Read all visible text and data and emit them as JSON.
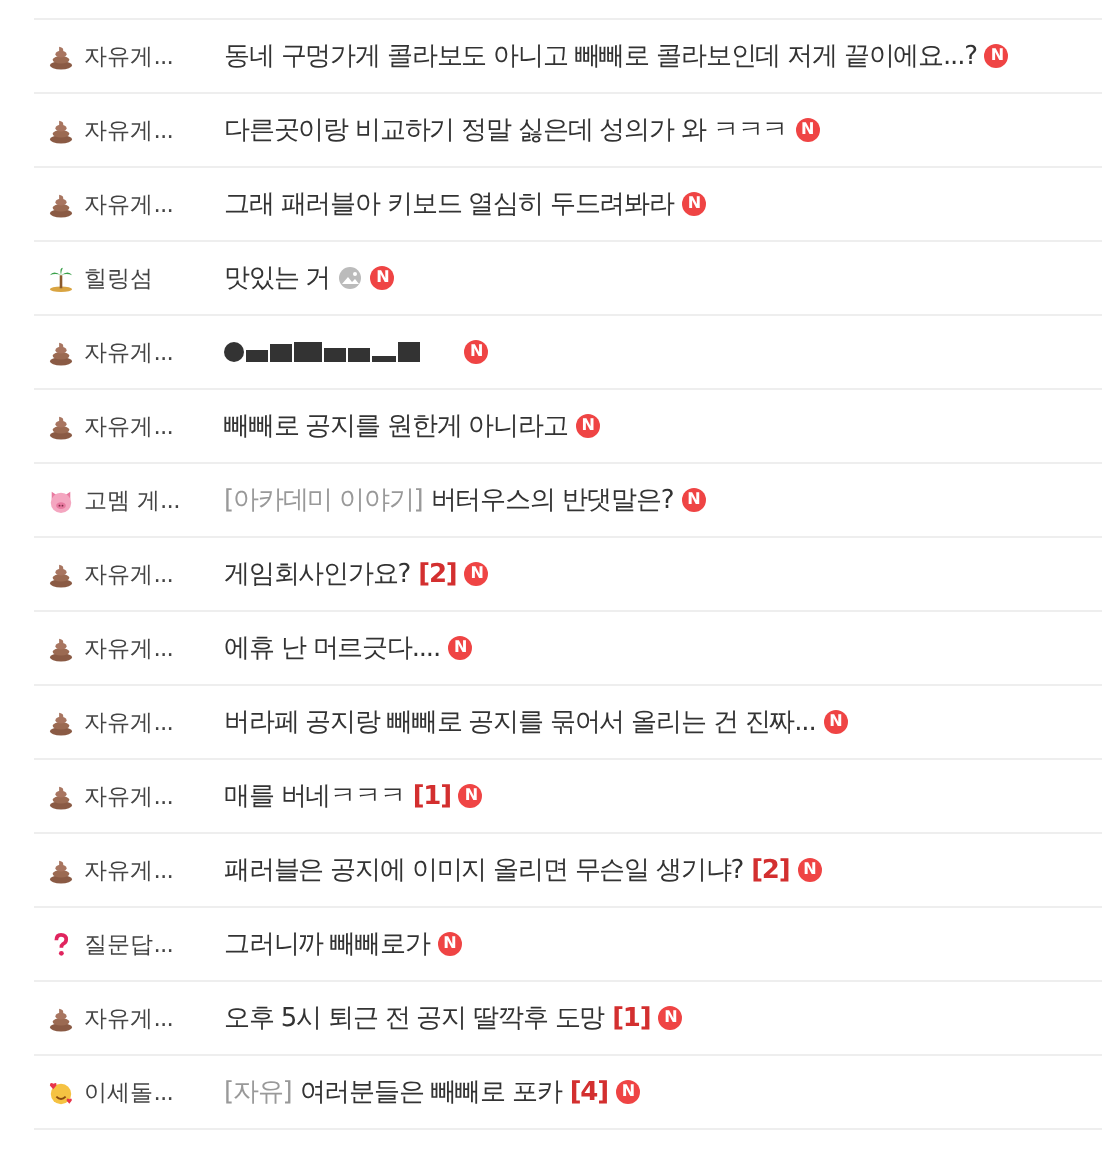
{
  "rows": [
    {
      "kind": "poop",
      "board": "자유게...",
      "prefix": "",
      "title": "동네 구멍가게 콜라보도 아니고 빼빼로 콜라보인데 저게 끝이에요...?",
      "redacted": false,
      "has_image": false,
      "comments": "",
      "badge": "N"
    },
    {
      "kind": "poop",
      "board": "자유게...",
      "prefix": "",
      "title": "다른곳이랑 비교하기 정말 싫은데 성의가 와 ㅋㅋㅋ",
      "redacted": false,
      "has_image": false,
      "comments": "",
      "badge": "N"
    },
    {
      "kind": "poop",
      "board": "자유게...",
      "prefix": "",
      "title": "그래 패러블아 키보드 열심히 두드려봐라",
      "redacted": false,
      "has_image": false,
      "comments": "",
      "badge": "N"
    },
    {
      "kind": "palm",
      "board": "힐링섬",
      "prefix": "",
      "title": "맛있는 거",
      "redacted": false,
      "has_image": true,
      "comments": "",
      "badge": "N"
    },
    {
      "kind": "poop",
      "board": "자유게...",
      "prefix": "",
      "title": "",
      "redacted": true,
      "has_image": false,
      "comments": "",
      "badge": "N"
    },
    {
      "kind": "poop",
      "board": "자유게...",
      "prefix": "",
      "title": "빼빼로 공지를 원한게 아니라고",
      "redacted": false,
      "has_image": false,
      "comments": "",
      "badge": "N"
    },
    {
      "kind": "pig",
      "board": "고멤 게...",
      "prefix": "[아카데미 이야기]",
      "title": "버터우스의 반댓말은?",
      "redacted": false,
      "has_image": false,
      "comments": "",
      "badge": "N"
    },
    {
      "kind": "poop",
      "board": "자유게...",
      "prefix": "",
      "title": "게임회사인가요?",
      "redacted": false,
      "has_image": false,
      "comments": "[2]",
      "badge": "N"
    },
    {
      "kind": "poop",
      "board": "자유게...",
      "prefix": "",
      "title": "에휴 난 머르긋다....",
      "redacted": false,
      "has_image": false,
      "comments": "",
      "badge": "N"
    },
    {
      "kind": "poop",
      "board": "자유게...",
      "prefix": "",
      "title": "버라페 공지랑 빼빼로 공지를 묶어서 올리는 건 진짜...",
      "redacted": false,
      "has_image": false,
      "comments": "",
      "badge": "N"
    },
    {
      "kind": "poop",
      "board": "자유게...",
      "prefix": "",
      "title": "매를 버네ㅋㅋㅋ",
      "redacted": false,
      "has_image": false,
      "comments": "[1]",
      "badge": "N"
    },
    {
      "kind": "poop",
      "board": "자유게...",
      "prefix": "",
      "title": "패러블은 공지에 이미지 올리면 무슨일 생기냐?",
      "redacted": false,
      "has_image": false,
      "comments": "[2]",
      "badge": "N"
    },
    {
      "kind": "question",
      "board": "질문답...",
      "prefix": "",
      "title": "그러니까 빼빼로가",
      "redacted": false,
      "has_image": false,
      "comments": "",
      "badge": "N"
    },
    {
      "kind": "poop",
      "board": "자유게...",
      "prefix": "",
      "title": "오후 5시 퇴근 전 공지 딸깍후 도망",
      "redacted": false,
      "has_image": false,
      "comments": "[1]",
      "badge": "N"
    },
    {
      "kind": "heart",
      "board": "이세돌...",
      "prefix": "[자유]",
      "title": "여러분들은 빼빼로 포카",
      "redacted": false,
      "has_image": false,
      "comments": "[4]",
      "badge": "N"
    }
  ]
}
